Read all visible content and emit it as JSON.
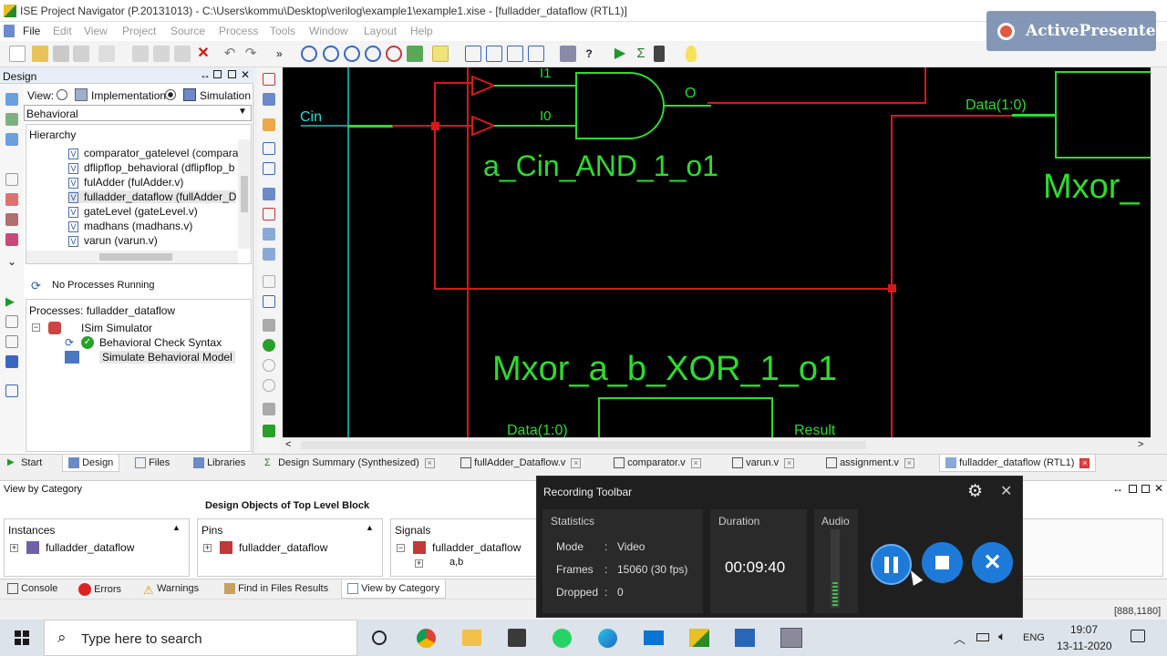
{
  "window": {
    "title": "ISE Project Navigator (P.20131013) - C:\\Users\\kommu\\Desktop\\verilog\\example1\\example1.xise - [fulladder_dataflow (RTL1)]"
  },
  "menu": [
    "File",
    "Edit",
    "View",
    "Project",
    "Source",
    "Process",
    "Tools",
    "Window",
    "Layout",
    "Help"
  ],
  "design_panel": {
    "header": "Design",
    "view_label": "View:",
    "view_impl": "Implementation",
    "view_sim": "Simulation",
    "behavior_select": "Behavioral",
    "hierarchy_label": "Hierarchy",
    "hierarchy_items": [
      "comparator_gatelevel (compara",
      "dflipflop_behavioral (dflipflop_b",
      "fulAdder (fulAdder.v)",
      "fulladder_dataflow (fullAdder_D",
      "gateLevel (gateLevel.v)",
      "madhans (madhans.v)",
      "varun (varun.v)"
    ],
    "no_processes": "No Processes Running",
    "processes_label": "Processes: fulladder_dataflow",
    "process_items": [
      "ISim Simulator",
      "Behavioral Check Syntax",
      "Simulate Behavioral Model"
    ]
  },
  "schematic": {
    "labels": {
      "cin": "Cin",
      "i1": "I1",
      "i0": "I0",
      "o": "O",
      "and_name": "a_Cin_AND_1_o1",
      "data10_top": "Data(1:0)",
      "mxor_partial": "Mxor_",
      "xor_name": "Mxor_a_b_XOR_1_o1",
      "data10_bottom": "Data(1:0)",
      "result": "Result"
    },
    "colors": {
      "background": "#000000",
      "net": "#d81818",
      "gate": "#2ddc2d",
      "port": "#0a9a9a"
    }
  },
  "start_tabs": [
    "Start",
    "Design",
    "Files",
    "Libraries"
  ],
  "doc_tabs": [
    "Design Summary (Synthesized)",
    "fullAdder_Dataflow.v",
    "comparator.v",
    "varun.v",
    "assignment.v",
    "fulladder_dataflow (RTL1)"
  ],
  "bottom_panel": {
    "header": "View by Category",
    "title": "Design Objects of Top Level Block",
    "instances_label": "Instances",
    "instances_item": "fulladder_dataflow",
    "pins_label": "Pins",
    "pins_item": "fulladder_dataflow",
    "signals_label": "Signals",
    "signals_item": "fulladder_dataflow",
    "signals_sub": "a,b"
  },
  "bottom_tabs": [
    "Console",
    "Errors",
    "Warnings",
    "Find in Files Results",
    "View by Category"
  ],
  "status": {
    "coords": "[888,1180]"
  },
  "recording": {
    "title": "Recording Toolbar",
    "statistics_label": "Statistics",
    "mode_label": "Mode",
    "mode_value": "Video",
    "frames_label": "Frames",
    "frames_value": "15060 (30 fps)",
    "dropped_label": "Dropped",
    "dropped_value": "0",
    "duration_label": "Duration",
    "duration_value": "00:09:40",
    "audio_label": "Audio",
    "colon": ":"
  },
  "watermark": {
    "text": "ActivePresenter"
  },
  "taskbar": {
    "search_placeholder": "Type here to search",
    "lang": "ENG",
    "time": "19:07",
    "date": "13-11-2020"
  }
}
